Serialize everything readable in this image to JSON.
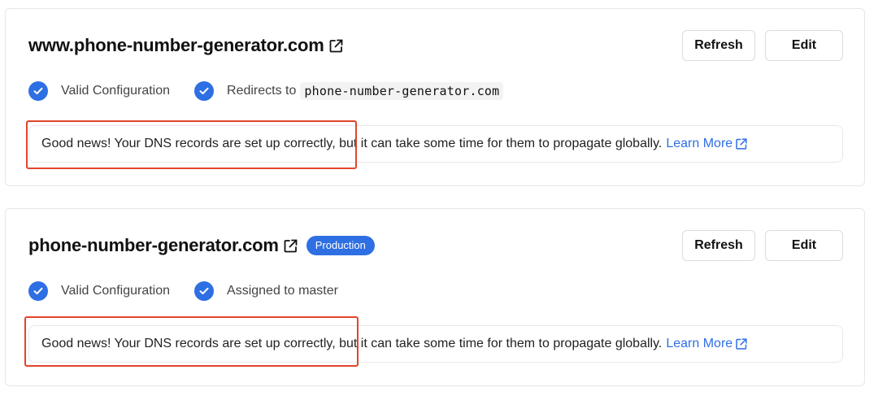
{
  "domains": [
    {
      "name": "www.phone-number-generator.com",
      "badge": "",
      "actions": {
        "refresh_label": "Refresh",
        "edit_label": "Edit"
      },
      "status": [
        {
          "icon": "check-circle-icon",
          "label": "Valid Configuration"
        },
        {
          "icon": "check-circle-icon",
          "label": "Redirects to",
          "code": "phone-number-generator.com"
        }
      ],
      "message": "Good news! Your DNS records are set up correctly, but it can take some time for them to propagate globally.",
      "learn_more": "Learn More"
    },
    {
      "name": "phone-number-generator.com",
      "badge": "Production",
      "actions": {
        "refresh_label": "Refresh",
        "edit_label": "Edit"
      },
      "status": [
        {
          "icon": "check-circle-icon",
          "label": "Valid Configuration"
        },
        {
          "icon": "check-circle-icon",
          "label": "Assigned to master"
        }
      ],
      "message": "Good news! Your DNS records are set up correctly, but it can take some time for them to propagate globally.",
      "learn_more": "Learn More"
    }
  ],
  "colors": {
    "accent": "#2f6fe4",
    "highlight_box": "#e2452b",
    "card_border": "#e6e6e6"
  }
}
